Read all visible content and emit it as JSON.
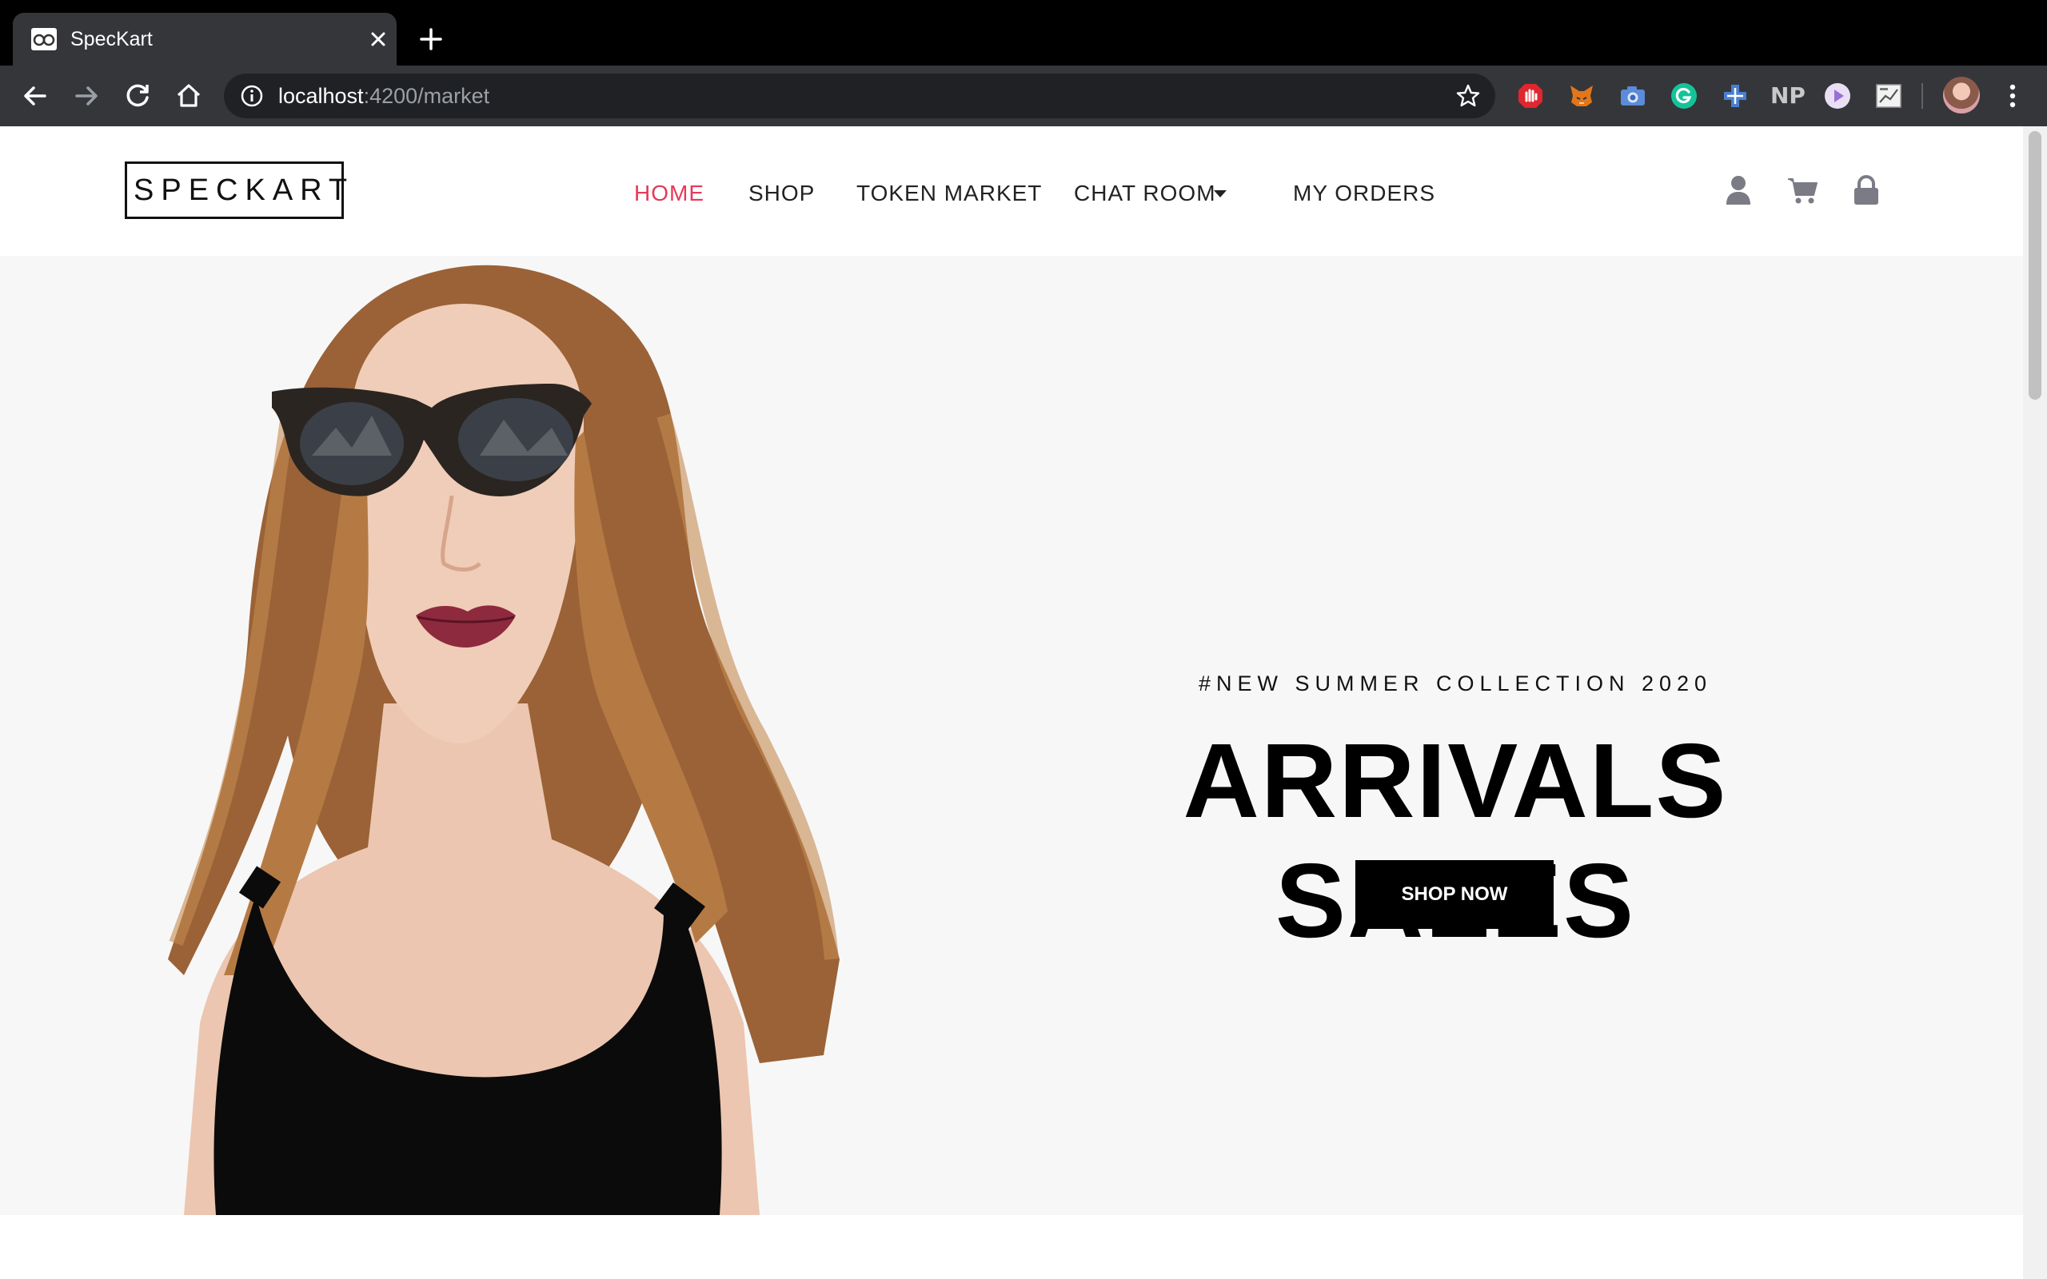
{
  "browser": {
    "tab_title": "SpecKart",
    "url_host": "localhost",
    "url_path": ":4200/market",
    "extensions": [
      "adblock-icon",
      "metamask-fox-icon",
      "camera-icon",
      "grammarly-icon",
      "plus-cross-icon",
      "np-icon",
      "play-icon",
      "chart-icon"
    ],
    "ext_np_label": "NP"
  },
  "site": {
    "logo": "SPECKART",
    "nav": {
      "home": "HOME",
      "shop": "SHOP",
      "token_market": "TOKEN MARKET",
      "chat_room": "CHAT ROOM",
      "my_orders": "MY ORDERS"
    },
    "colors": {
      "accent": "#e8385a",
      "text": "#222222",
      "button_bg": "#000000"
    }
  },
  "hero": {
    "subtitle": "#NEW SUMMER COLLECTION 2020",
    "title": "ARRIVALS SALES",
    "cta": "SHOP NOW"
  }
}
